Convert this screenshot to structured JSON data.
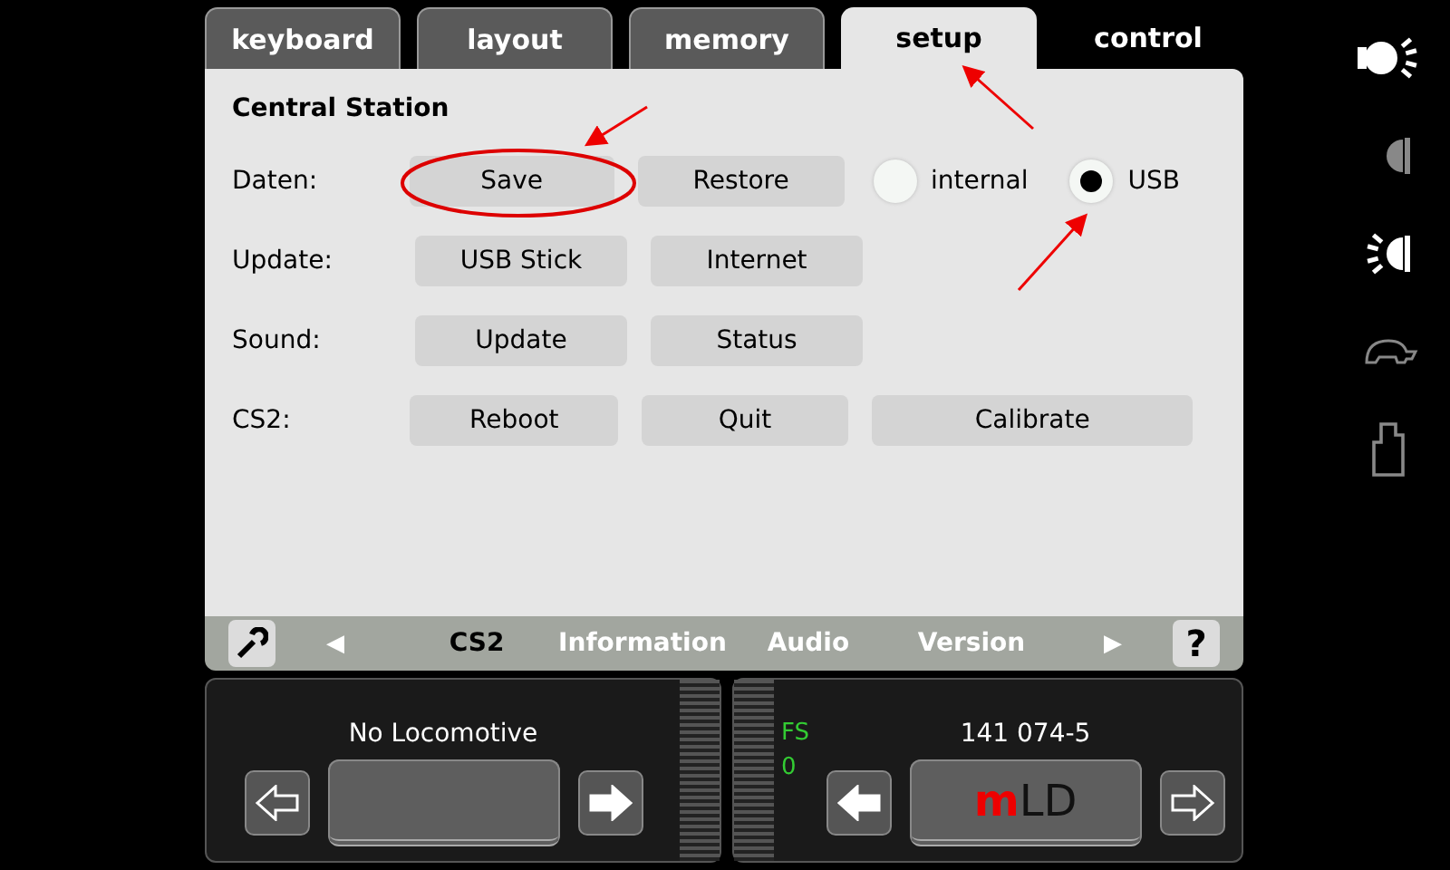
{
  "tabs": [
    {
      "label": "keyboard",
      "selected": false,
      "kind": "tab"
    },
    {
      "label": "layout",
      "selected": false,
      "kind": "tab"
    },
    {
      "label": "memory",
      "selected": false,
      "kind": "tab"
    },
    {
      "label": "setup",
      "selected": true,
      "kind": "tab"
    },
    {
      "label": "control",
      "selected": false,
      "kind": "plain"
    }
  ],
  "section_title": "Central Station",
  "rows": [
    {
      "label": "Daten:",
      "items": [
        {
          "kind": "button",
          "label": "Save"
        },
        {
          "kind": "button",
          "label": "Restore"
        },
        {
          "kind": "radio",
          "label": "internal",
          "selected": false
        },
        {
          "kind": "radio",
          "label": "USB",
          "selected": true
        }
      ]
    },
    {
      "label": "Update:",
      "items": [
        {
          "kind": "button",
          "label": "USB Stick"
        },
        {
          "kind": "button",
          "label": "Internet"
        }
      ]
    },
    {
      "label": "Sound:",
      "items": [
        {
          "kind": "button",
          "label": "Update"
        },
        {
          "kind": "button",
          "label": "Status"
        }
      ]
    },
    {
      "label": "CS2:",
      "items": [
        {
          "kind": "button",
          "label": "Reboot"
        },
        {
          "kind": "button",
          "label": "Quit"
        },
        {
          "kind": "wide",
          "label": "Calibrate"
        }
      ]
    }
  ],
  "nav": {
    "left_arrow": "◀",
    "right_arrow": "▶",
    "help": "?",
    "items": [
      {
        "label": "CS2",
        "selected": true
      },
      {
        "label": "Information",
        "selected": false
      },
      {
        "label": "Audio",
        "selected": false
      },
      {
        "label": "Version",
        "selected": false
      }
    ]
  },
  "locos": [
    {
      "name": "No Locomotive",
      "level": 0,
      "left_filled": false,
      "right_filled": true
    },
    {
      "name": "141 074-5",
      "speed_label": "FS",
      "speed": "0",
      "logo": "**m**LD",
      "level": 0,
      "left_filled": true,
      "right_filled": false
    }
  ],
  "side_icons": [
    {
      "kind": "lamp",
      "on": true
    },
    {
      "kind": "dim",
      "on": false
    },
    {
      "kind": "headlight",
      "on": true
    },
    {
      "kind": "turtle",
      "on": false
    },
    {
      "kind": "weight",
      "on": false
    }
  ]
}
